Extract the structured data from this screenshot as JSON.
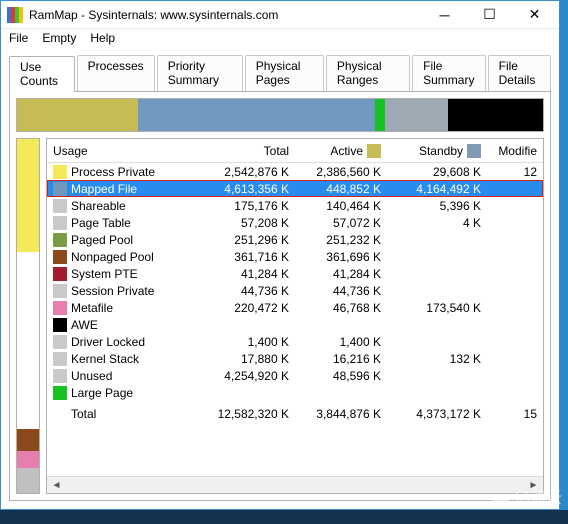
{
  "titlebar": {
    "text": "RamMap - Sysinternals: www.sysinternals.com"
  },
  "menu": {
    "file": "File",
    "empty": "Empty",
    "help": "Help"
  },
  "tabs": {
    "use_counts": "Use Counts",
    "processes": "Processes",
    "priority_summary": "Priority Summary",
    "physical_pages": "Physical Pages",
    "physical_ranges": "Physical Ranges",
    "file_summary": "File Summary",
    "file_details": "File Details"
  },
  "headers": {
    "usage": "Usage",
    "total": "Total",
    "active": "Active",
    "standby": "Standby",
    "modified": "Modifie"
  },
  "stackbar": [
    {
      "color": "#c5bc55",
      "pct": 23
    },
    {
      "color": "#7099bf",
      "pct": 45
    },
    {
      "color": "#18c223",
      "pct": 2
    },
    {
      "color": "#9fa9b3",
      "pct": 12
    },
    {
      "color": "#000000",
      "pct": 18
    }
  ],
  "sidebar": [
    {
      "color": "#f5e95a",
      "pct": 32
    },
    {
      "color": "#ffffff",
      "pct": 50
    },
    {
      "color": "#8a4a1c",
      "pct": 6
    },
    {
      "color": "#e67fb0",
      "pct": 5
    },
    {
      "color": "#c0c0c0",
      "pct": 7
    }
  ],
  "header_swatches": {
    "active": "#c5bc55",
    "standby": "#7f99b7"
  },
  "rows": [
    {
      "name": "Process Private",
      "color": "#f5e95a",
      "total": "2,542,876 K",
      "active": "2,386,560 K",
      "standby": "29,608 K",
      "mod": "12"
    },
    {
      "name": "Mapped File",
      "color": "#6f98be",
      "total": "4,613,356 K",
      "active": "448,852 K",
      "standby": "4,164,492 K",
      "mod": "",
      "selected": true
    },
    {
      "name": "Shareable",
      "color": "#c9c9c9",
      "total": "175,176 K",
      "active": "140,464 K",
      "standby": "5,396 K",
      "mod": ""
    },
    {
      "name": "Page Table",
      "color": "#c9c9c9",
      "total": "57,208 K",
      "active": "57,072 K",
      "standby": "4 K",
      "mod": ""
    },
    {
      "name": "Paged Pool",
      "color": "#7a9c46",
      "total": "251,296 K",
      "active": "251,232 K",
      "standby": "",
      "mod": ""
    },
    {
      "name": "Nonpaged Pool",
      "color": "#8a4a1c",
      "total": "361,716 K",
      "active": "361,696 K",
      "standby": "",
      "mod": ""
    },
    {
      "name": "System PTE",
      "color": "#a11c2c",
      "total": "41,284 K",
      "active": "41,284 K",
      "standby": "",
      "mod": ""
    },
    {
      "name": "Session Private",
      "color": "#c9c9c9",
      "total": "44,736 K",
      "active": "44,736 K",
      "standby": "",
      "mod": ""
    },
    {
      "name": "Metafile",
      "color": "#e67fb0",
      "total": "220,472 K",
      "active": "46,768 K",
      "standby": "173,540 K",
      "mod": ""
    },
    {
      "name": "AWE",
      "color": "#000000",
      "total": "",
      "active": "",
      "standby": "",
      "mod": ""
    },
    {
      "name": "Driver Locked",
      "color": "#c9c9c9",
      "total": "1,400 K",
      "active": "1,400 K",
      "standby": "",
      "mod": ""
    },
    {
      "name": "Kernel Stack",
      "color": "#c9c9c9",
      "total": "17,880 K",
      "active": "16,216 K",
      "standby": "132 K",
      "mod": ""
    },
    {
      "name": "Unused",
      "color": "#c9c9c9",
      "total": "4,254,920 K",
      "active": "48,596 K",
      "standby": "",
      "mod": ""
    },
    {
      "name": "Large Page",
      "color": "#18c223",
      "total": "",
      "active": "",
      "standby": "",
      "mod": ""
    }
  ],
  "total_row": {
    "name": "Total",
    "total": "12,582,320 K",
    "active": "3,844,876 K",
    "standby": "4,373,172 K",
    "mod": "15"
  },
  "watermark": "亿速云"
}
